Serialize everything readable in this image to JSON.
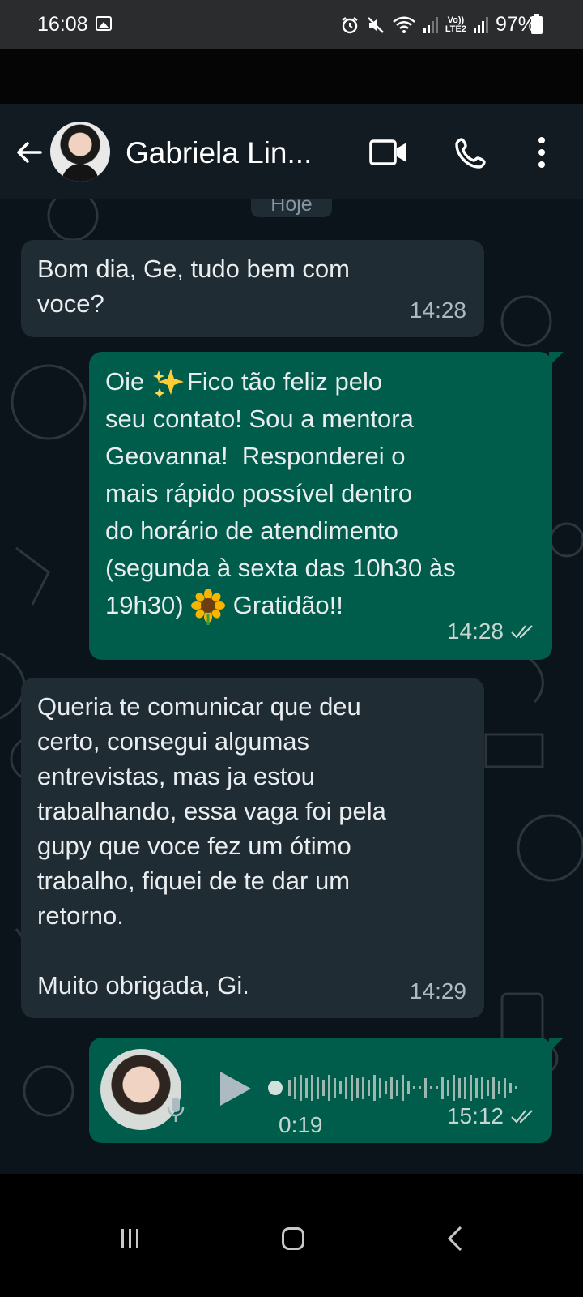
{
  "status_bar": {
    "time": "16:08",
    "battery": "97%",
    "network_label": "LTE2",
    "volte_label": "Vo))"
  },
  "header": {
    "contact_name": "Gabriela Lin...",
    "back_icon": "arrow-left-icon",
    "video_icon": "video-camera-icon",
    "call_icon": "phone-icon",
    "menu_icon": "more-vertical-icon"
  },
  "chat": {
    "date_chip": "Hoje",
    "messages": [
      {
        "direction": "incoming",
        "text": "Bom dia, Ge, tudo bem com\nvoce?",
        "time": "14:28"
      },
      {
        "direction": "outgoing",
        "text_part1": "Oie ",
        "text_part2": "Fico tão feliz pelo",
        "text_part3": "seu contato! Sou a mentora\nGeovanna!  Responderei o\nmais rápido possível dentro\ndo horário de atendimento\n(segunda à sexta das 10h30 às\n19h30) ",
        "text_part4": " Gratidão!!",
        "emoji_1": "sparkles",
        "emoji_2": "sunflower",
        "time": "14:28",
        "status": "read"
      },
      {
        "direction": "incoming",
        "text": "Queria te comunicar que deu\ncerto, consegui algumas\nentrevistas, mas ja estou\ntrabalhando, essa vaga foi pela\ngupy que voce fez um ótimo\ntrabalho, fiquei de te dar um\nretorno.\n\nMuito obrigada, Gi.",
        "time": "14:29"
      },
      {
        "direction": "outgoing",
        "type": "voice",
        "duration": "0:19",
        "time": "15:12",
        "status": "read"
      }
    ]
  },
  "colors": {
    "incoming_bubble": "#202c33",
    "outgoing_bubble": "#005c4b",
    "chat_bg": "#0b141a",
    "header_bg": "#121b22"
  }
}
